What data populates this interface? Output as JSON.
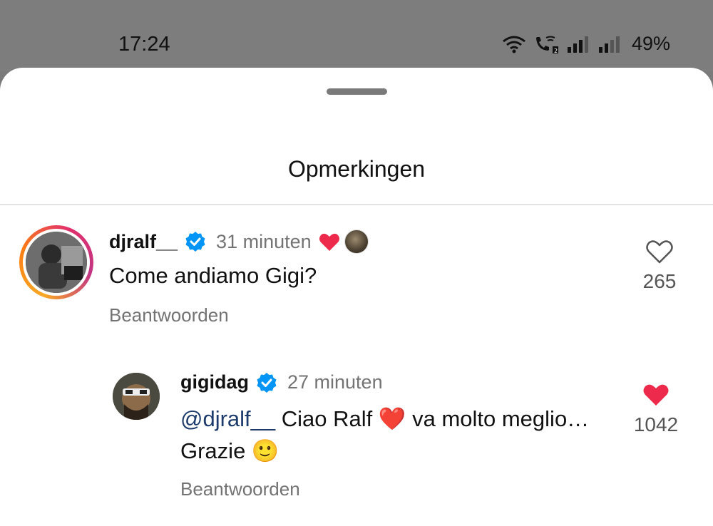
{
  "status_bar": {
    "time": "17:24",
    "battery": "49%",
    "icons": [
      "wifi-icon",
      "wifi-call-icon",
      "signal-icon",
      "signal-weak-icon"
    ]
  },
  "sheet": {
    "title": "Opmerkingen"
  },
  "comments": [
    {
      "username": "djralf__",
      "verified": true,
      "time": "31 minuten",
      "liked_by_author": true,
      "text": "Come andiamo Gigi?",
      "reply_label": "Beantwoorden",
      "likes": "265",
      "liked": false
    }
  ],
  "replies": [
    {
      "username": "gigidag",
      "verified": true,
      "time": "27 minuten",
      "mention": "@djralf__",
      "text_line1": " Ciao Ralf ❤️ va molto meglio…",
      "text_line2": "Grazie 🙂",
      "reply_label": "Beantwoorden",
      "likes": "1042",
      "liked": true
    }
  ],
  "colors": {
    "verified_blue": "#0095f6",
    "heart_red": "#ed2a4b",
    "mention_blue": "#1c3a6b",
    "secondary_text": "#737373"
  }
}
